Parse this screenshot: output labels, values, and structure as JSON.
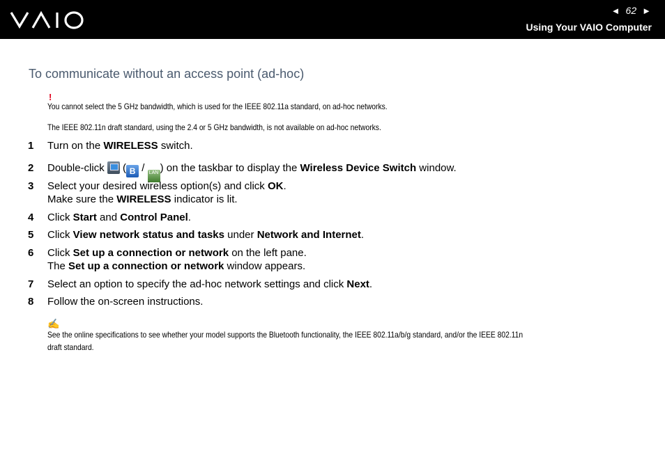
{
  "header": {
    "page_number": "62",
    "section": "Using Your VAIO Computer",
    "prev_arrow": "◄",
    "next_arrow": "►"
  },
  "title": "To communicate without an access point (ad-hoc)",
  "warning": {
    "mark": "!",
    "lines": [
      "You cannot select the 5 GHz bandwidth, which is used for the IEEE 802.11a standard, on ad-hoc networks.",
      "The IEEE 802.11n draft standard, using the 2.4 or 5 GHz bandwidth, is not available on ad-hoc networks."
    ]
  },
  "steps": [
    {
      "num": "1",
      "pre": "Turn on the ",
      "b1": "WIRELESS",
      "post": " switch."
    },
    {
      "num": "2",
      "pre": "Double-click ",
      "paren_open": " (",
      "slash": " / ",
      "paren_close": ") on the taskbar to display the ",
      "b1": "Wireless Device Switch",
      "post": " window."
    },
    {
      "num": "3",
      "pre": "Select your desired wireless option(s) and click ",
      "b1": "OK",
      "post": ".",
      "line2_pre": "Make sure the ",
      "line2_b": "WIRELESS",
      "line2_post": " indicator is lit."
    },
    {
      "num": "4",
      "pre": "Click ",
      "b1": "Start",
      "mid": " and ",
      "b2": "Control Panel",
      "post": "."
    },
    {
      "num": "5",
      "pre": "Click ",
      "b1": "View network status and tasks",
      "mid": " under ",
      "b2": "Network and Internet",
      "post": "."
    },
    {
      "num": "6",
      "pre": "Click ",
      "b1": "Set up a connection or network",
      "post": " on the left pane.",
      "line2_pre": "The ",
      "line2_b": "Set up a connection or network",
      "line2_post": " window appears."
    },
    {
      "num": "7",
      "pre": "Select an option to specify the ad-hoc network settings and click ",
      "b1": "Next",
      "post": "."
    },
    {
      "num": "8",
      "pre": "Follow the on-screen instructions."
    }
  ],
  "note": {
    "mark": "✍",
    "line1": "See the online specifications to see whether your model supports the Bluetooth functionality, the IEEE 802.11a/b/g standard, and/or the IEEE 802.11n",
    "line2": "draft standard."
  },
  "icons": {
    "lan_icon": "LAN",
    "bt_icon": "B",
    "wlan_icon": "LAN"
  }
}
